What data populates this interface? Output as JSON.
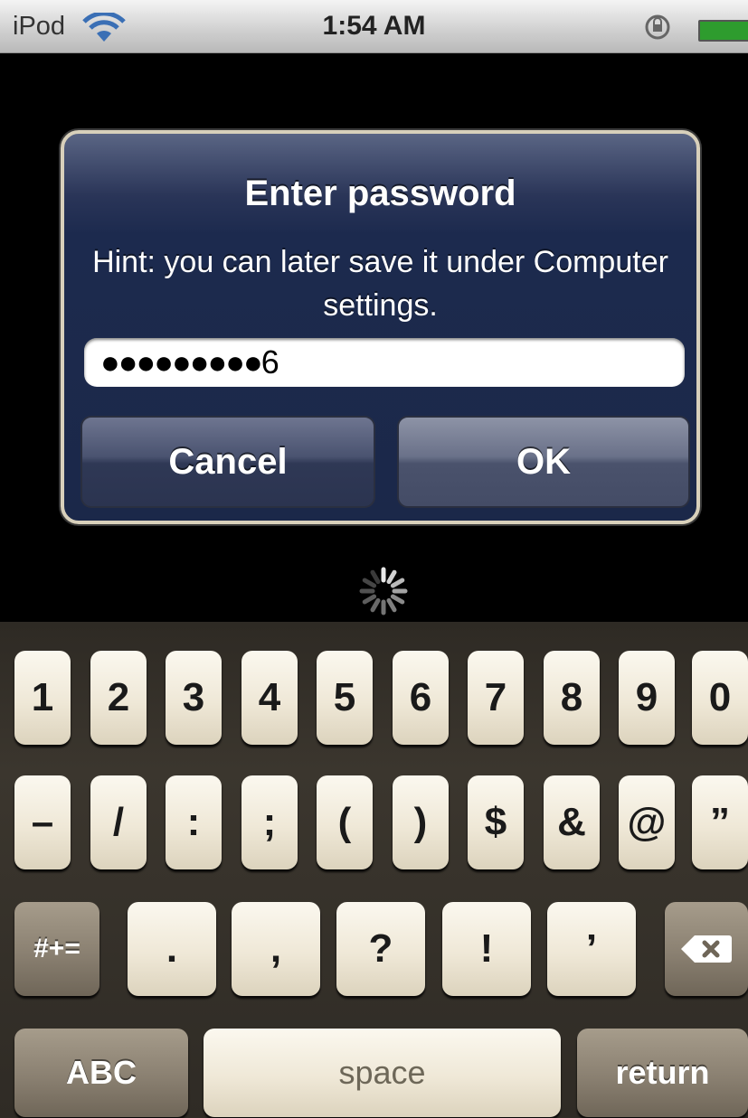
{
  "status_bar": {
    "carrier": "iPod",
    "time": "1:54 AM",
    "wifi_icon": "wifi-icon",
    "lock_icon": "rotation-lock-icon",
    "battery_icon": "battery-icon",
    "battery_color": "#2e9c2e"
  },
  "alert": {
    "title": "Enter password",
    "message": "Hint: you can later save it under Computer settings.",
    "password_value": "●●●●●●●●●6",
    "cancel_label": "Cancel",
    "ok_label": "OK",
    "background_color": "#1b2849"
  },
  "spinner": {
    "icon": "loading-spinner-icon"
  },
  "keyboard": {
    "row1": [
      "1",
      "2",
      "3",
      "4",
      "5",
      "6",
      "7",
      "8",
      "9",
      "0"
    ],
    "row2": [
      "–",
      "/",
      ":",
      ";",
      "(",
      ")",
      "$",
      "&",
      "@",
      "”"
    ],
    "row3": {
      "shift_label": "#+=",
      "keys": [
        ".",
        ",",
        "?",
        "!",
        "’"
      ],
      "delete_icon": "backspace-icon"
    },
    "row4": {
      "abc_label": "ABC",
      "space_label": "space",
      "return_label": "return"
    }
  }
}
